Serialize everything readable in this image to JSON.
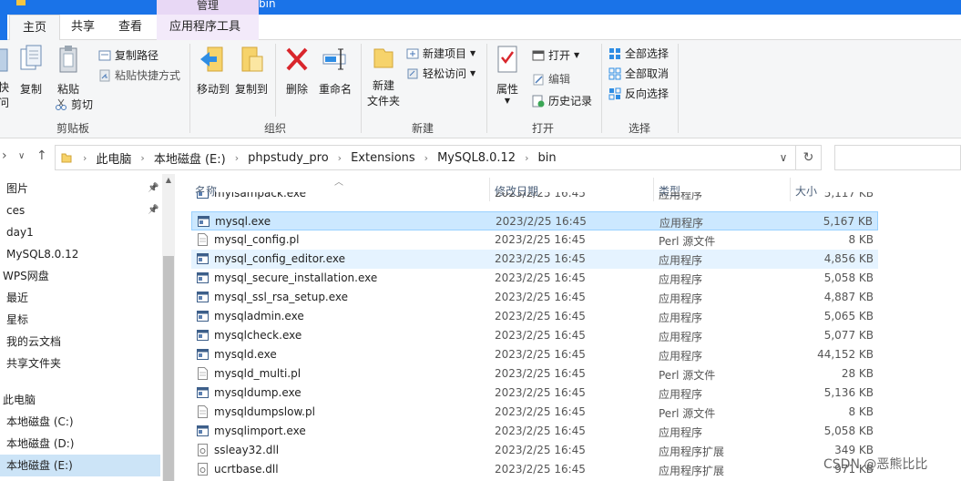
{
  "window": {
    "manage_tab": "管理",
    "title": "bin"
  },
  "ribbon_tabs": {
    "home": "主页",
    "share": "共享",
    "view": "查看",
    "app_tools": "应用程序工具"
  },
  "ribbon": {
    "clipboard": {
      "pin_partial": "快",
      "pin_partial2": "问",
      "copy": "复制",
      "paste": "粘贴",
      "copy_path": "复制路径",
      "paste_shortcut": "粘贴快捷方式",
      "cut": "剪切",
      "label": "剪贴板"
    },
    "organize": {
      "move_to": "移动到",
      "copy_to": "复制到",
      "delete": "删除",
      "rename": "重命名",
      "label": "组织"
    },
    "new": {
      "new_folder_line1": "新建",
      "new_folder_line2": "文件夹",
      "new_item": "新建项目",
      "easy_access": "轻松访问",
      "label": "新建"
    },
    "open": {
      "properties": "属性",
      "open": "打开",
      "edit": "编辑",
      "history": "历史记录",
      "label": "打开"
    },
    "select": {
      "select_all": "全部选择",
      "select_none": "全部取消",
      "invert": "反向选择",
      "label": "选择"
    }
  },
  "address": {
    "crumbs": [
      "此电脑",
      "本地磁盘 (E:)",
      "phpstudy_pro",
      "Extensions",
      "MySQL8.0.12",
      "bin"
    ]
  },
  "nav_pane": {
    "items": [
      {
        "label": "图片",
        "pinned": true
      },
      {
        "label": "ces",
        "pinned": true
      },
      {
        "label": "day1",
        "pinned": false
      },
      {
        "label": "MySQL8.0.12",
        "pinned": false
      },
      {
        "label": "WPS网盘",
        "pinned": false
      },
      {
        "label": "最近",
        "pinned": false
      },
      {
        "label": "星标",
        "pinned": false
      },
      {
        "label": "我的云文档",
        "pinned": false
      },
      {
        "label": "共享文件夹",
        "pinned": false
      },
      {
        "label": "此电脑",
        "pinned": false
      },
      {
        "label": "本地磁盘 (C:)",
        "pinned": false
      },
      {
        "label": "本地磁盘 (D:)",
        "pinned": false
      },
      {
        "label": "本地磁盘 (E:)",
        "pinned": false
      }
    ]
  },
  "columns": {
    "name": "名称",
    "date": "修改日期",
    "type": "类型",
    "size": "大小"
  },
  "files": [
    {
      "name": "myisampack.exe",
      "date": "2023/2/25 16:45",
      "type": "应用程序",
      "size": "5,117 KB",
      "icon": "exe"
    },
    {
      "name": "mysql.exe",
      "date": "2023/2/25 16:45",
      "type": "应用程序",
      "size": "5,167 KB",
      "icon": "exe"
    },
    {
      "name": "mysql_config.pl",
      "date": "2023/2/25 16:45",
      "type": "Perl 源文件",
      "size": "8 KB",
      "icon": "doc"
    },
    {
      "name": "mysql_config_editor.exe",
      "date": "2023/2/25 16:45",
      "type": "应用程序",
      "size": "4,856 KB",
      "icon": "exe"
    },
    {
      "name": "mysql_secure_installation.exe",
      "date": "2023/2/25 16:45",
      "type": "应用程序",
      "size": "5,058 KB",
      "icon": "exe"
    },
    {
      "name": "mysql_ssl_rsa_setup.exe",
      "date": "2023/2/25 16:45",
      "type": "应用程序",
      "size": "4,887 KB",
      "icon": "exe"
    },
    {
      "name": "mysqladmin.exe",
      "date": "2023/2/25 16:45",
      "type": "应用程序",
      "size": "5,065 KB",
      "icon": "exe"
    },
    {
      "name": "mysqlcheck.exe",
      "date": "2023/2/25 16:45",
      "type": "应用程序",
      "size": "5,077 KB",
      "icon": "exe"
    },
    {
      "name": "mysqld.exe",
      "date": "2023/2/25 16:45",
      "type": "应用程序",
      "size": "44,152 KB",
      "icon": "exe"
    },
    {
      "name": "mysqld_multi.pl",
      "date": "2023/2/25 16:45",
      "type": "Perl 源文件",
      "size": "28 KB",
      "icon": "doc"
    },
    {
      "name": "mysqldump.exe",
      "date": "2023/2/25 16:45",
      "type": "应用程序",
      "size": "5,136 KB",
      "icon": "exe"
    },
    {
      "name": "mysqldumpslow.pl",
      "date": "2023/2/25 16:45",
      "type": "Perl 源文件",
      "size": "8 KB",
      "icon": "doc"
    },
    {
      "name": "mysqlimport.exe",
      "date": "2023/2/25 16:45",
      "type": "应用程序",
      "size": "5,058 KB",
      "icon": "exe"
    },
    {
      "name": "ssleay32.dll",
      "date": "2023/2/25 16:45",
      "type": "应用程序扩展",
      "size": "349 KB",
      "icon": "dll"
    },
    {
      "name": "ucrtbase.dll",
      "date": "2023/2/25 16:45",
      "type": "应用程序扩展",
      "size": "971 KB",
      "icon": "dll"
    }
  ],
  "watermark": "CSDN @恶熊比比"
}
